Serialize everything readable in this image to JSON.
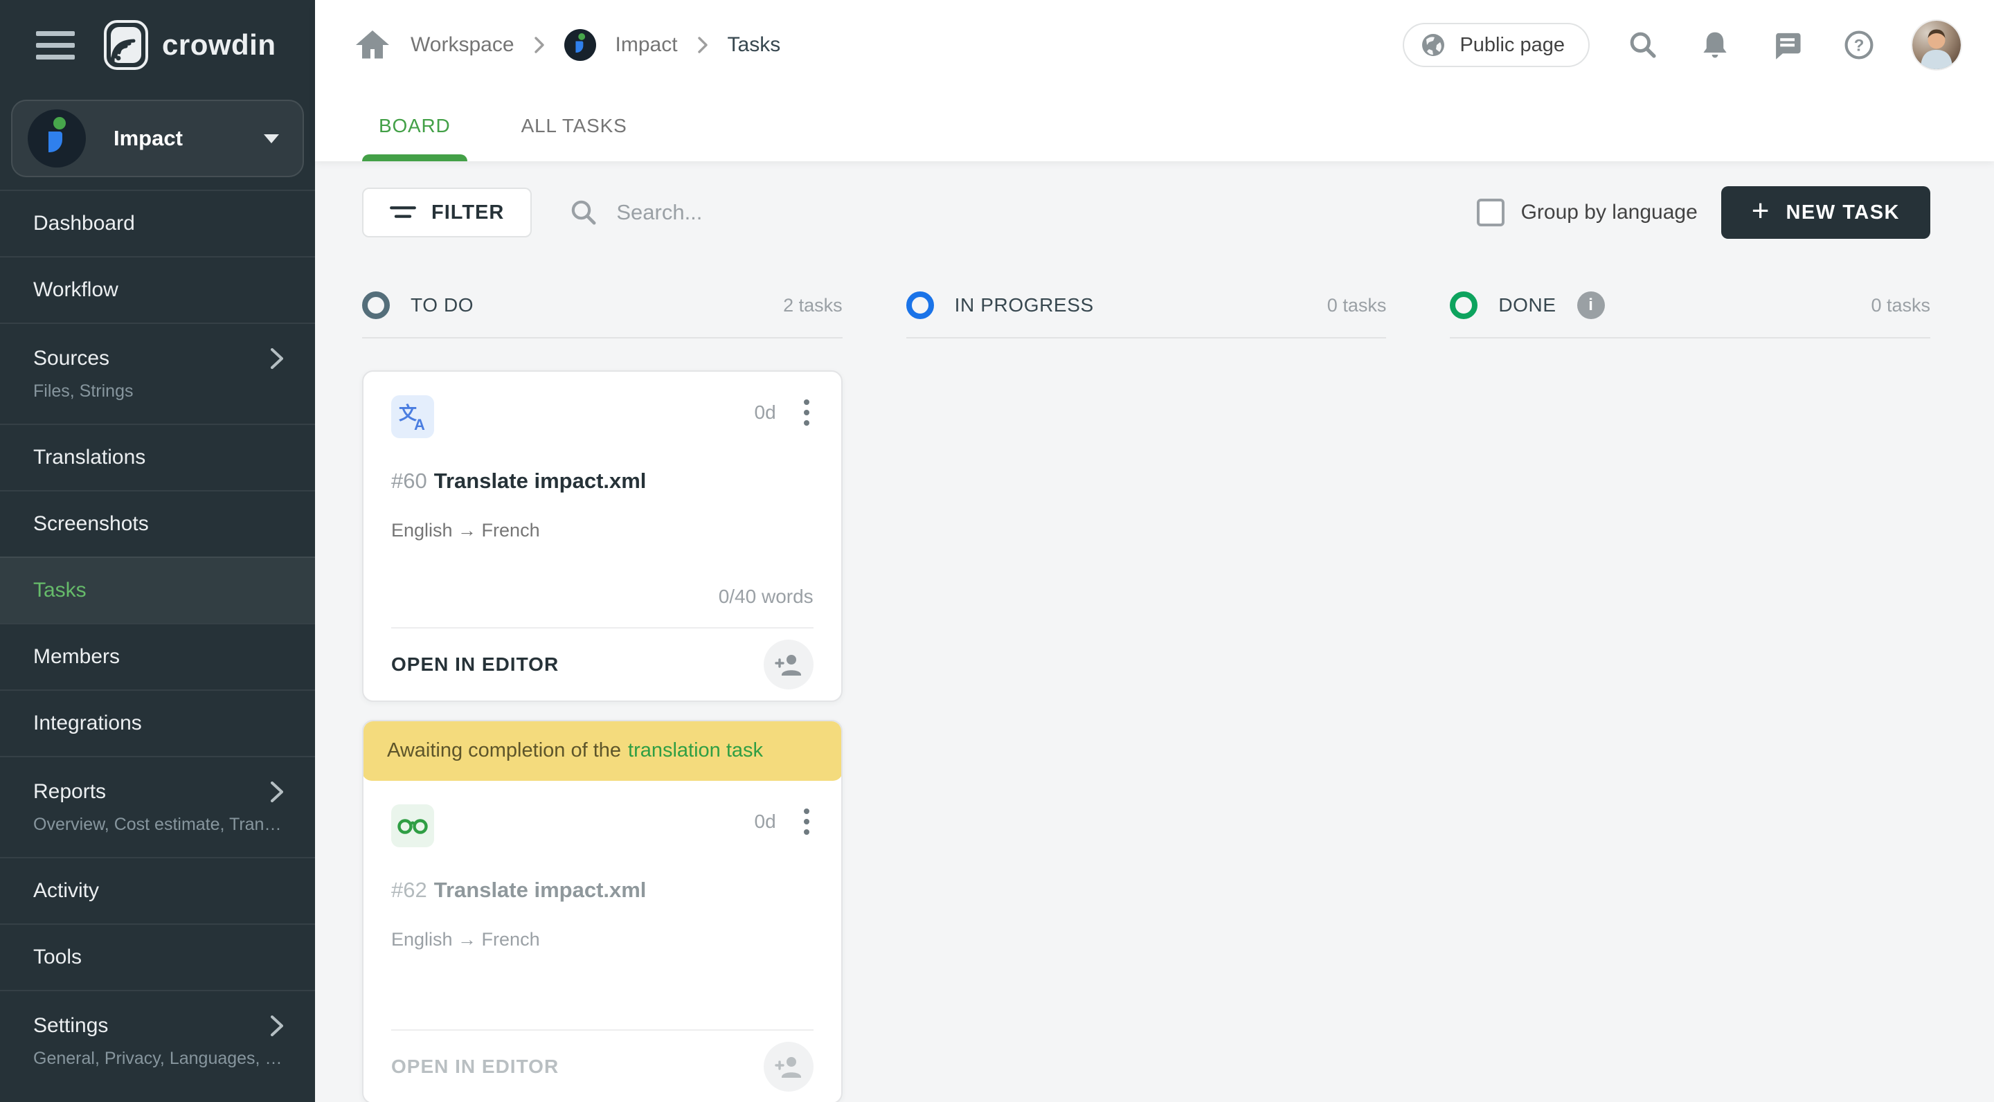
{
  "app": {
    "brand": "crowdin"
  },
  "colors": {
    "accent_green": "#43a047",
    "sidebar_active_green": "#66bb6a",
    "sidebar_bg": "#263238",
    "new_task_bg": "#263238",
    "banner_bg": "#f4db7d",
    "banner_text": "#5d552a",
    "banner_link": "#2f9e44",
    "todo": "#546e7a",
    "in_progress": "#1a73e8",
    "done": "#0da35e"
  },
  "sidebar": {
    "project": {
      "name": "Impact"
    },
    "items": [
      {
        "label": "Dashboard"
      },
      {
        "label": "Workflow"
      },
      {
        "label": "Sources",
        "sub": "Files, Strings"
      },
      {
        "label": "Translations"
      },
      {
        "label": "Screenshots"
      },
      {
        "label": "Tasks"
      },
      {
        "label": "Members"
      },
      {
        "label": "Integrations"
      },
      {
        "label": "Reports",
        "sub": "Overview, Cost estimate, Transl…"
      },
      {
        "label": "Activity"
      },
      {
        "label": "Tools"
      },
      {
        "label": "Settings",
        "sub": "General, Privacy, Languages, Q…"
      }
    ]
  },
  "header": {
    "breadcrumb": {
      "home": "Workspace",
      "project": "Impact",
      "current": "Tasks"
    },
    "public_page_label": "Public page"
  },
  "tabs": {
    "board": "BOARD",
    "all_tasks": "ALL TASKS"
  },
  "toolbar": {
    "filter_label": "FILTER",
    "search_placeholder": "Search...",
    "group_by_language_label": "Group by language",
    "new_task_label": "NEW TASK"
  },
  "board": {
    "columns": [
      {
        "name": "TO DO",
        "count": "2 tasks",
        "color": "#546e7a"
      },
      {
        "name": "IN PROGRESS",
        "count": "0 tasks",
        "color": "#1a73e8"
      },
      {
        "name": "DONE",
        "count": "0 tasks",
        "color": "#0da35e",
        "info": "i"
      }
    ],
    "cards": [
      {
        "id": "#60",
        "title": "Translate impact.xml",
        "langs": "English → French",
        "due": "0d",
        "words": "0/40 words",
        "action": "OPEN IN EDITOR",
        "type": "translate"
      },
      {
        "id": "#62",
        "title": "Translate impact.xml",
        "langs": "English → French",
        "due": "0d",
        "action": "OPEN IN EDITOR",
        "type": "proofread",
        "banner": {
          "text": "Awaiting completion of the",
          "link": "translation task"
        }
      }
    ]
  }
}
